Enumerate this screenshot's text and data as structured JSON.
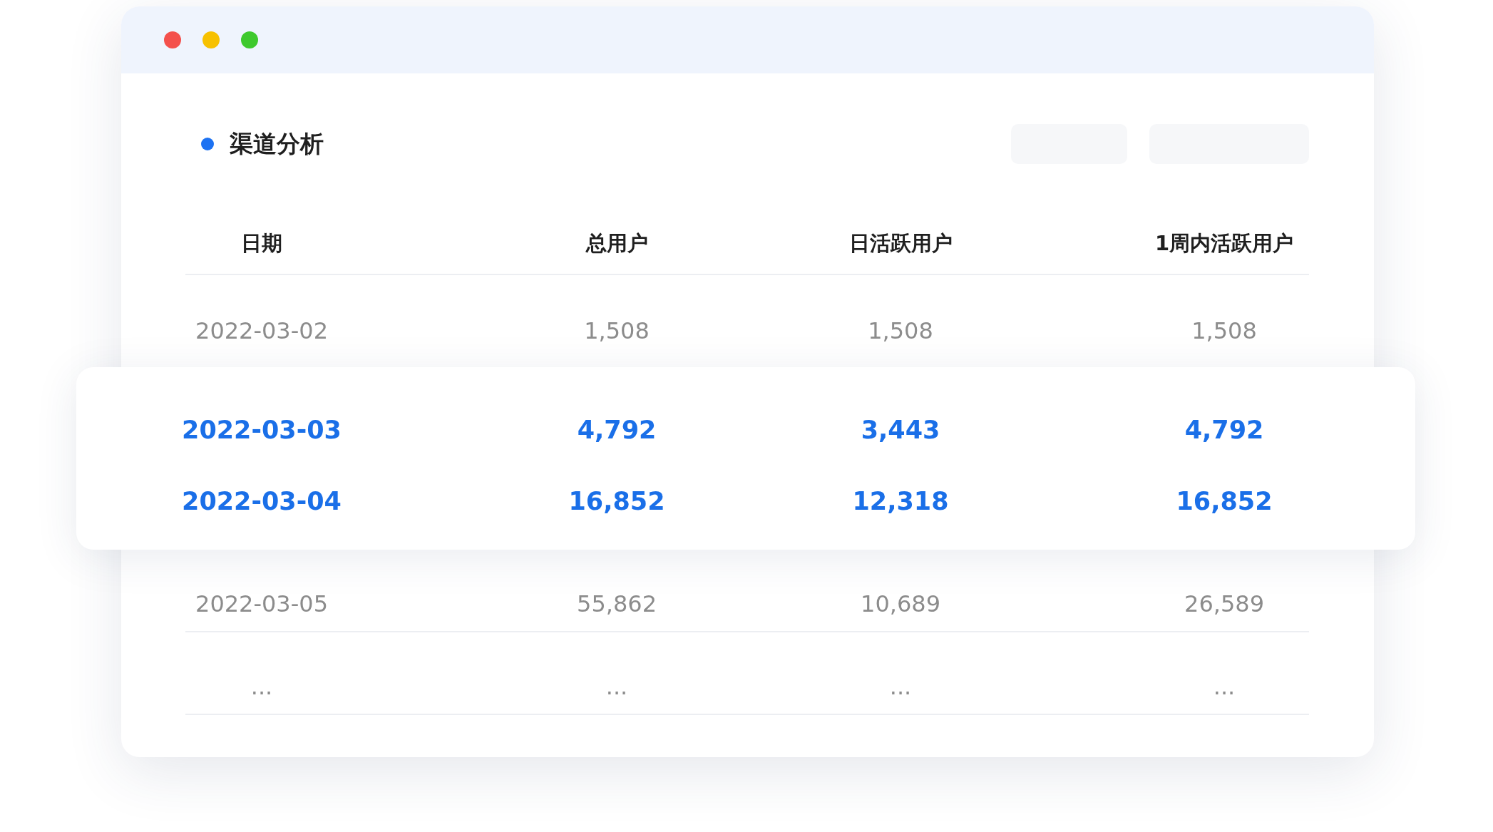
{
  "panel": {
    "title": "渠道分析"
  },
  "table": {
    "columns": [
      "日期",
      "总用户",
      "日活跃用户",
      "1周内活跃用户"
    ],
    "rows": [
      {
        "cells": [
          "2022-03-02",
          "1,508",
          "1,508",
          "1,508"
        ],
        "highlighted": false
      },
      {
        "cells": [
          "2022-03-03",
          "4,792",
          "3,443",
          "4,792"
        ],
        "highlighted": true
      },
      {
        "cells": [
          "2022-03-04",
          "16,852",
          "12,318",
          "16,852"
        ],
        "highlighted": true
      },
      {
        "cells": [
          "2022-03-05",
          "55,862",
          "10,689",
          "26,589"
        ],
        "highlighted": false
      },
      {
        "cells": [
          "...",
          "...",
          "...",
          "..."
        ],
        "highlighted": false
      }
    ]
  }
}
